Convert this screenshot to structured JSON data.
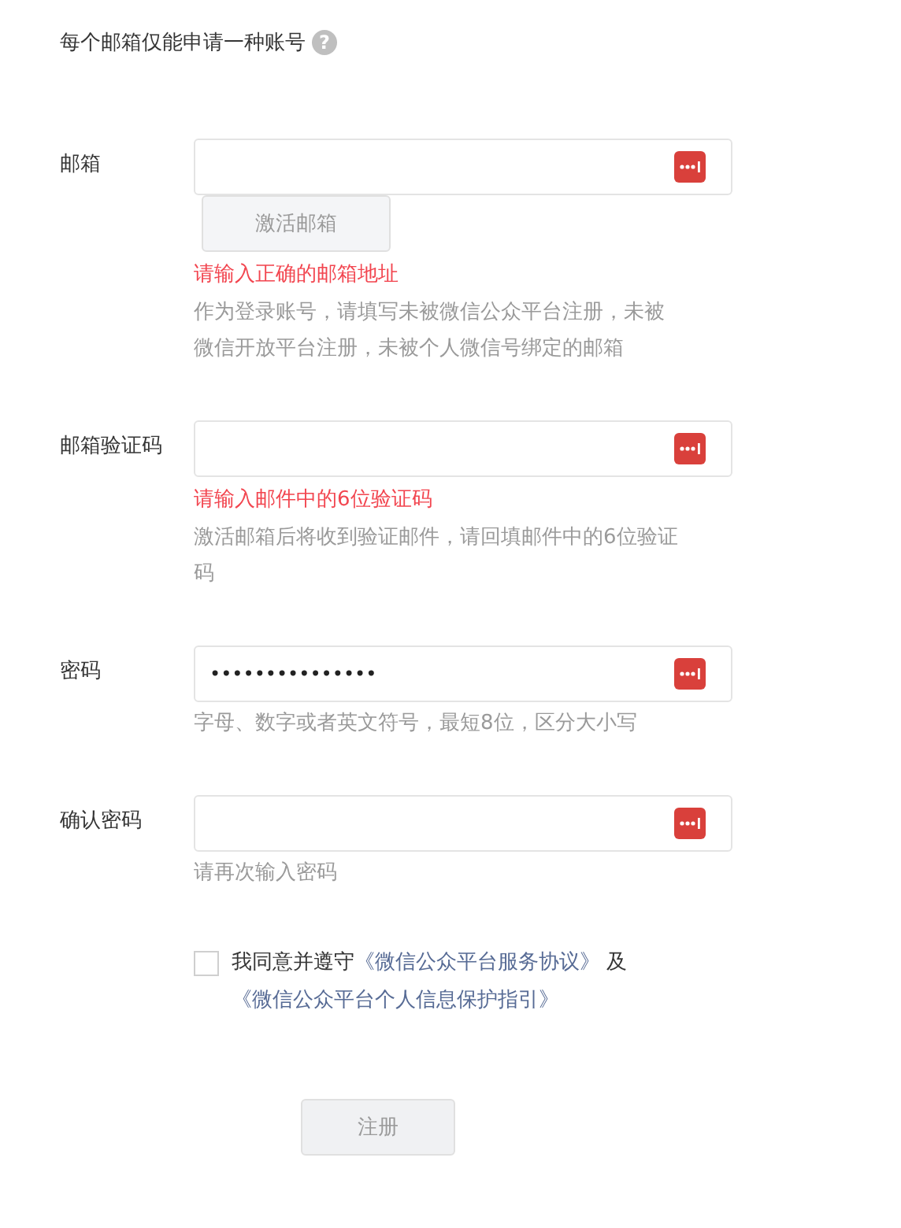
{
  "notice": {
    "text": "每个邮箱仅能申请一种账号",
    "help_icon": "?"
  },
  "fields": [
    {
      "label": "邮箱",
      "button": "激活邮箱",
      "error": "请输入正确的邮箱地址",
      "hint": "作为登录账号，请填写未被微信公众平台注册，未被微信开放平台注册，未被个人微信号绑定的邮箱"
    },
    {
      "label": "邮箱验证码",
      "error": "请输入邮件中的6位验证码",
      "hint": "激活邮箱后将收到验证邮件，请回填邮件中的6位验证码"
    },
    {
      "label": "密码",
      "value": "•••••••••••••••",
      "hint": "字母、数字或者英文符号，最短8位，区分大小写"
    },
    {
      "label": "确认密码",
      "hint": "请再次输入密码"
    }
  ],
  "agreement": {
    "checked": false,
    "text": "我同意并遵守",
    "link_1": "《微信公众平台服务协议》",
    "joiner": "及",
    "link_2": "《微信公众平台个人信息保护指引》"
  },
  "submit": "注册"
}
